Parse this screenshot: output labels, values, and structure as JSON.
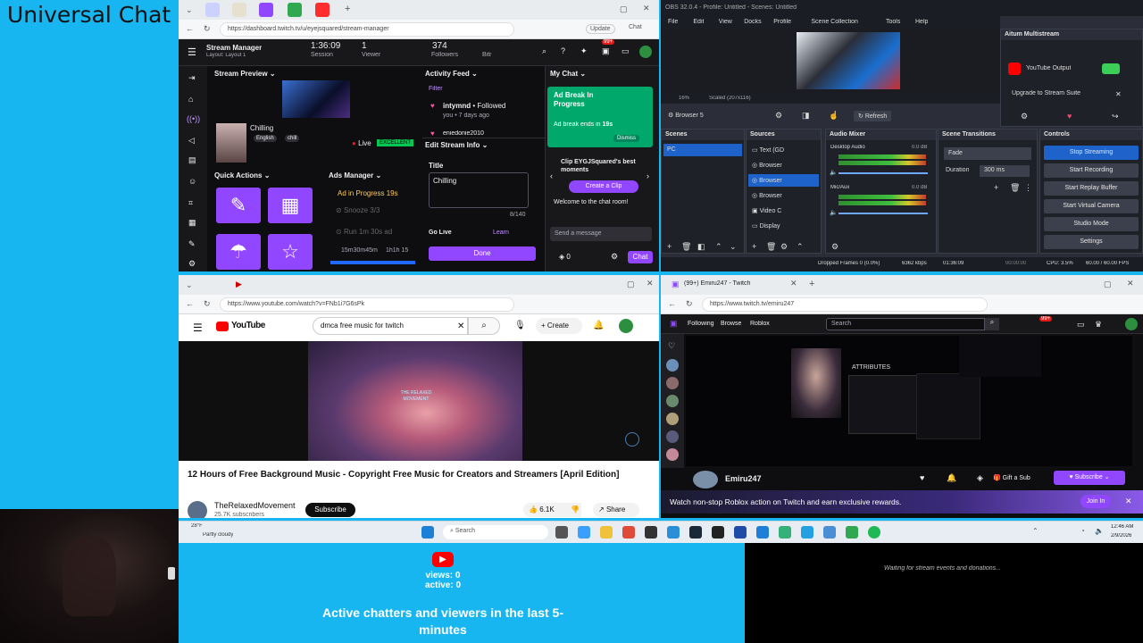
{
  "left": {
    "title": "Universal Chat"
  },
  "twitch_dashboard": {
    "url": "https://dashboard.twitch.tv/u/eyejsquared/stream-manager",
    "update_label": "Update",
    "chat_label": "Chat",
    "header": {
      "title": "Stream Manager",
      "layout": "Layout: Layout 1",
      "session_value": "1:36:09",
      "session_label": "Session",
      "viewer_value": "1",
      "viewer_label": "Viewer",
      "followers_value": "374",
      "followers_label": "Followers",
      "bitrate_label": "Bitr",
      "notif_badge": "99+"
    },
    "stream_preview": {
      "title": "Stream Preview",
      "stream_title": "Chilling",
      "language": "English",
      "tag": "chill",
      "live_label": "Live",
      "health": "EXCELLENT"
    },
    "quick_actions": {
      "title": "Quick Actions"
    },
    "ads_manager": {
      "title": "Ads Manager",
      "in_progress": "Ad in Progress",
      "in_progress_time": "19s",
      "snooze": "Snooze 3/3",
      "run": "Run 1m 30s ad",
      "time1": "15m30m45m",
      "time2": "1h1h 15"
    },
    "activity_feed": {
      "title": "Activity Feed",
      "filter": "Filter",
      "item1_user": "intymnd",
      "item1_action": "• Followed",
      "item1_sub": "you • 7 days ago",
      "item2_user": "eniedonie2010"
    },
    "edit_stream_info": {
      "title": "Edit Stream Info",
      "title_label": "Title",
      "title_value": "Chilling",
      "char_count": "8/140",
      "go_live": "Go Live",
      "learn": "Learn",
      "done": "Done"
    },
    "my_chat": {
      "title": "My Chat",
      "ad_break_title": "Ad Break In Progress",
      "ad_break_ends": "Ad break ends in",
      "ad_break_time": "19s",
      "dismiss": "Dismiss",
      "clip_title": "Clip EYGJSquared's best moments",
      "create_clip": "Create a Clip",
      "welcome": "Welcome to the chat room!",
      "send_placeholder": "Send a message",
      "points": "0",
      "chat_button": "Chat"
    }
  },
  "obs": {
    "title": "OBS 32.0.4 - Profile: Untitled - Scenes: Untitled",
    "menu": [
      "File",
      "Edit",
      "View",
      "Docks",
      "Profile",
      "Scene Collection",
      "Tools",
      "Help"
    ],
    "zoom": "16%",
    "scale_label": "Scaled (207x116)",
    "source_selected": "Browser 5",
    "refresh": "Refresh",
    "aitum": {
      "title": "Aitum Multistream",
      "youtube_output": "YouTube Output",
      "upgrade": "Upgrade to Stream Suite"
    },
    "scenes": {
      "title": "Scenes",
      "items": [
        "PC"
      ]
    },
    "sources": {
      "title": "Sources",
      "items": [
        "Text (GD",
        "Browser",
        "Browser",
        "Browser",
        "Video C",
        "Display"
      ]
    },
    "audio_mixer": {
      "title": "Audio Mixer",
      "ch1_name": "Desktop Audio",
      "ch1_db": "0.0 dB",
      "ch2_name": "Mic/Aux",
      "ch2_db": "0.0 dB"
    },
    "transitions": {
      "title": "Scene Transitions",
      "type": "Fade",
      "duration_label": "Duration",
      "duration_value": "300 ms"
    },
    "controls": {
      "title": "Controls",
      "buttons": [
        "Stop Streaming",
        "Start Recording",
        "Start Replay Buffer",
        "Start Virtual Camera",
        "Studio Mode",
        "Settings"
      ]
    },
    "status": {
      "dropped": "Dropped Frames 0 (0.0%)",
      "bitrate": "6362 kbps",
      "live_time": "01:36:09",
      "rec_time": "00:00:00",
      "cpu": "CPU: 3.5%",
      "fps": "60.00 / 60.00 FPS"
    }
  },
  "youtube": {
    "url": "https://www.youtube.com/watch?v=FNb1i7G6sPk",
    "logo": "YouTube",
    "search_value": "dmca free music for twitch",
    "create": "Create",
    "video_title": "12 Hours of Free Background Music - Copyright Free Music for Creators and Streamers [April Edition]",
    "channel": "TheRelaxedMovement",
    "subscribers": "25.7K subscribers",
    "subscribe": "Subscribe",
    "likes": "6.1K",
    "share": "Share",
    "overlay_text": "THE RELAXED MOVEMENT"
  },
  "twitch_viewer": {
    "tab_title": "(99+) Emiru247 - Twitch",
    "url": "https://www.twitch.tv/emiru247",
    "nav": [
      "Following",
      "Browse",
      "Roblox"
    ],
    "search_placeholder": "Search",
    "badge": "99+",
    "streamer": "Emiru247",
    "gift_sub": "Gift a Sub",
    "subscribe": "Subscribe",
    "banner": "Watch non-stop Roblox action on Twitch and earn exclusive rewards.",
    "join": "Join In",
    "game_panel": "ATTRIBUTES"
  },
  "taskbar": {
    "temp": "28°F",
    "weather": "Partly cloudy",
    "search": "Search",
    "time": "12:46 AM",
    "date": "2/9/2026"
  },
  "bottom_overlay": {
    "views": "views: 0",
    "active": "active: 0",
    "caption": "Active chatters and viewers in the last 5-minutes",
    "waiting": "Waiting for stream events and donations..."
  },
  "colors": {
    "background": "#18b6f0",
    "twitch_purple": "#9146ff",
    "twitch_dark": "#0e0e10",
    "obs_dark": "#2b2e38",
    "youtube_red": "#ff0000"
  }
}
